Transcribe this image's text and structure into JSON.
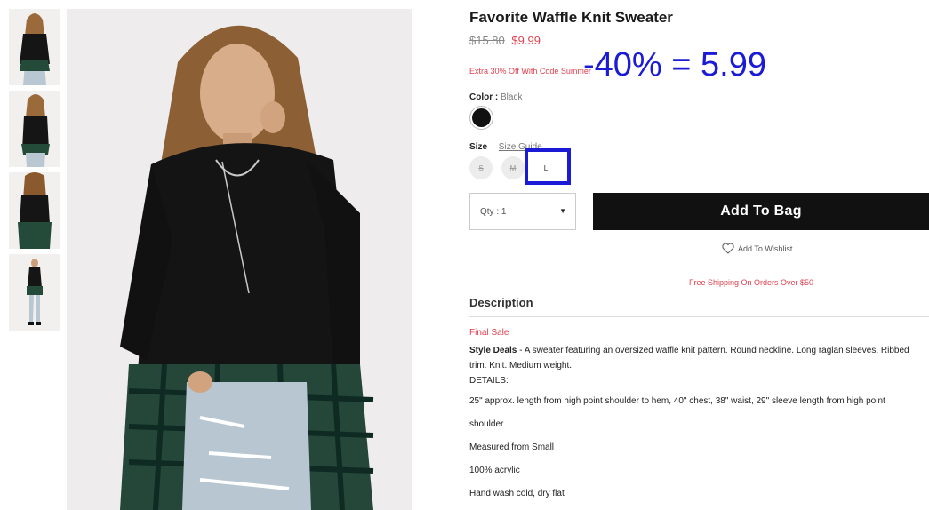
{
  "product": {
    "title": "Favorite Waffle Knit Sweater",
    "price_old": "$15.80",
    "price_new": "$9.99",
    "promo": "Extra 30% Off With Code Summer",
    "color_label": "Color :",
    "color_value": "Black",
    "swatch_color": "#111111",
    "size_label": "Size",
    "size_guide": "Size Guide",
    "sizes": [
      {
        "label": "S",
        "available": false
      },
      {
        "label": "M",
        "available": false
      },
      {
        "label": "L",
        "available": true
      }
    ],
    "qty_label": "Qty : 1",
    "add_to_bag": "Add To Bag",
    "wishlist": "Add To Wishlist",
    "shipping": "Free Shipping On Orders Over $50"
  },
  "annotation": {
    "text": "-40% = 5.99",
    "color": "#1b1bd6"
  },
  "description": {
    "heading": "Description",
    "final_sale": "Final Sale",
    "brand": "Style Deals",
    "body": " - A sweater featuring an oversized waffle knit pattern. Round neckline. Long raglan sleeves. Ribbed trim. Knit. Medium weight.",
    "details_label": "DETAILS:",
    "details": [
      "25\" approx. length from high point shoulder to hem, 40\" chest, 38\" waist, 29\" sleeve length from high point",
      "shoulder",
      "Measured from Small",
      "100% acrylic",
      "Hand wash cold, dry flat"
    ]
  },
  "colors": {
    "accent_red": "#e1414f",
    "button_black": "#111111"
  }
}
